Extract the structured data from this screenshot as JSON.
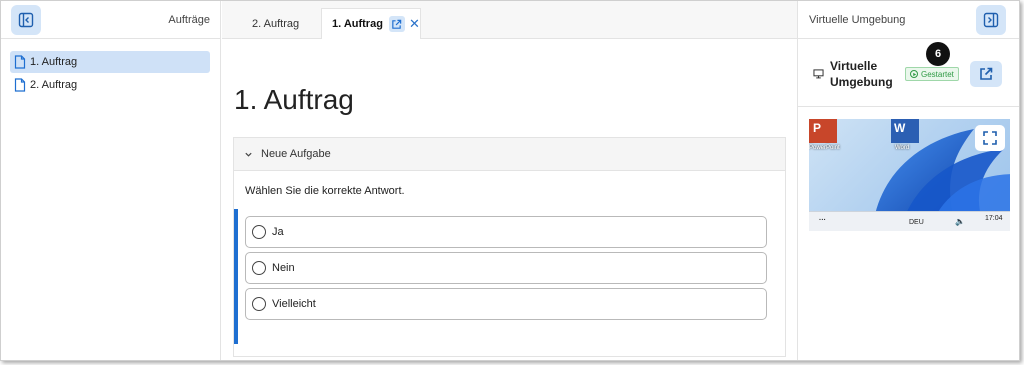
{
  "left_panel": {
    "title": "Aufträge",
    "items": [
      {
        "label": "1. Auftrag",
        "active": true
      },
      {
        "label": "2. Auftrag",
        "active": false
      }
    ]
  },
  "tabs": [
    {
      "label": "2. Auftrag",
      "active": false
    },
    {
      "label": "1. Auftrag",
      "active": true
    }
  ],
  "main": {
    "heading": "1. Auftrag",
    "section_title": "Neue Aufgabe",
    "question": "Wählen Sie die korrekte Antwort.",
    "options": [
      "Ja",
      "Nein",
      "Vielleicht"
    ]
  },
  "right_panel": {
    "title": "Virtuelle Umgebung",
    "env_label_line1": "Virtuelle",
    "env_label_line2": "Umgebung",
    "status": "Gestartet",
    "step_badge": "6",
    "desktop": {
      "apps": [
        {
          "label": "PowerPoint",
          "letter": "P"
        },
        {
          "label": "Word",
          "letter": "W"
        }
      ],
      "taskbar_lang": "DEU",
      "taskbar_time": "17:04",
      "taskbar_dots": "···"
    }
  },
  "colors": {
    "accent": "#1f6fd1",
    "button_bg": "#d4e5f8",
    "status_green": "#2f9a45"
  }
}
